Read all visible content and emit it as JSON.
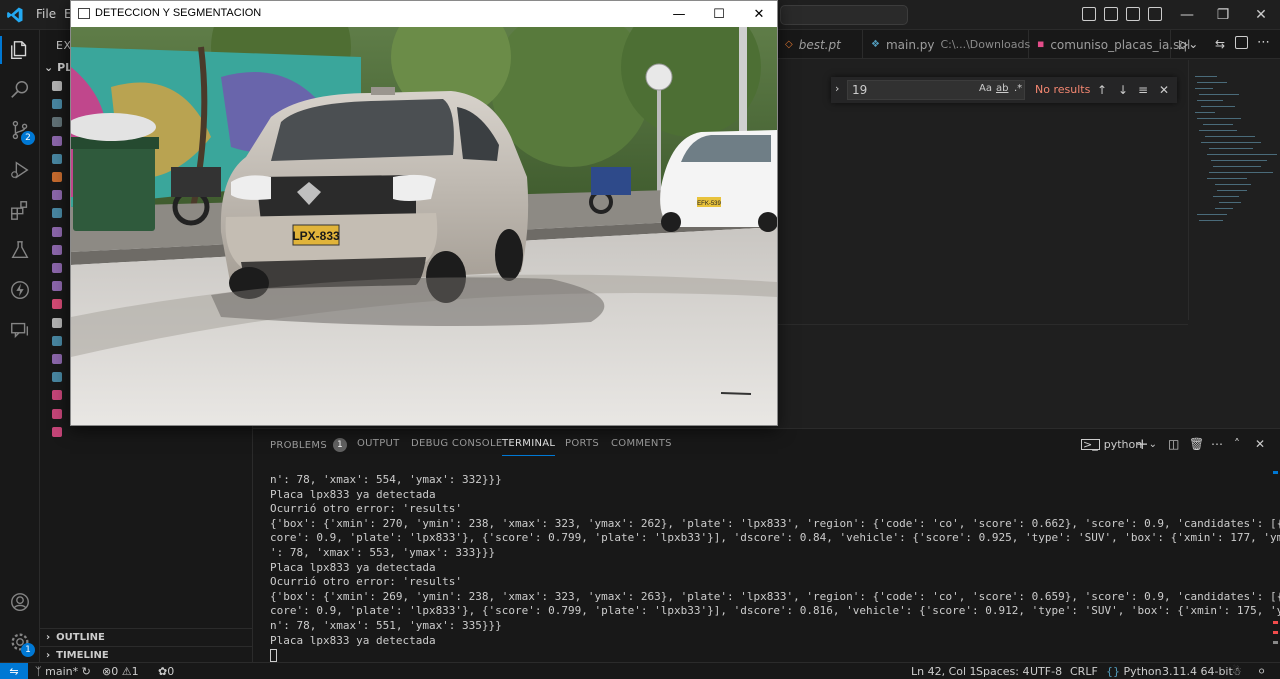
{
  "titlebar": {
    "menu": [
      "File",
      "E"
    ],
    "window_controls": [
      "minimize-icon",
      "restore-icon",
      "close-icon"
    ]
  },
  "activitybar": {
    "items": [
      "explorer-icon",
      "search-icon",
      "source-control-icon",
      "run-debug-icon",
      "extensions-icon",
      "testing-icon",
      "lightning-icon",
      "comments-icon"
    ],
    "source_control_badge": "2",
    "accounts_icon": "account-icon",
    "manage_badge": "1"
  },
  "sidebar": {
    "title": "EXP",
    "folder": "PLA",
    "outline": "OUTLINE",
    "timeline": "TIMELINE",
    "file_colors": [
      "#cccccc",
      "#519aba",
      "#6d8086",
      "#a074c4",
      "#519aba",
      "#e37933",
      "#a074c4",
      "#519aba",
      "#a074c4",
      "#a074c4",
      "#a074c4",
      "#a074c4",
      "#f55385",
      "#cccccc",
      "#519aba",
      "#a074c4",
      "#519aba",
      "#e44d8a",
      "#e44d8a",
      "#e44d8a"
    ]
  },
  "tabs": [
    {
      "label": "best.pt",
      "sub": ""
    },
    {
      "label": "main.py",
      "sub": "C:\\...\\Downloads"
    },
    {
      "label": "comuniso_placas_ia.sql",
      "sub": ""
    }
  ],
  "find": {
    "value": "19",
    "opt_case": "Aa",
    "opt_word": "ab",
    "opt_regex": ".*",
    "result": "No results"
  },
  "panel": {
    "tabs": [
      "PROBLEMS",
      "OUTPUT",
      "DEBUG CONSOLE",
      "TERMINAL",
      "PORTS",
      "COMMENTS"
    ],
    "problems_count": "1",
    "active_tab": "TERMINAL",
    "terminal_name": "python",
    "terminal_lines": [
      "n': 78, 'xmax': 554, 'ymax': 332}}}",
      "Placa lpx833 ya detectada",
      "Ocurrió otro error: 'results'",
      "{'box': {'xmin': 270, 'ymin': 238, 'xmax': 323, 'ymax': 262}, 'plate': 'lpx833', 'region': {'code': 'co', 'score': 0.662}, 'score': 0.9, 'candidates': [{'s",
      "core': 0.9, 'plate': 'lpx833'}, {'score': 0.799, 'plate': 'lpxb33'}], 'dscore': 0.84, 'vehicle': {'score': 0.925, 'type': 'SUV', 'box': {'xmin': 177, 'ymin",
      "': 78, 'xmax': 553, 'ymax': 333}}}",
      "Placa lpx833 ya detectada",
      "Ocurrió otro error: 'results'",
      "{'box': {'xmin': 269, 'ymin': 238, 'xmax': 323, 'ymax': 263}, 'plate': 'lpx833', 'region': {'code': 'co', 'score': 0.659}, 'score': 0.9, 'candidates': [{'s",
      "core': 0.9, 'plate': 'lpx833'}, {'score': 0.799, 'plate': 'lpxb33'}], 'dscore': 0.816, 'vehicle': {'score': 0.912, 'type': 'SUV', 'box': {'xmin': 175, 'ymi",
      "n': 78, 'xmax': 551, 'ymax': 335}}}",
      "Placa lpx833 ya detectada"
    ]
  },
  "statusbar": {
    "branch": "main*",
    "errors": "0",
    "warnings": "1",
    "ports": "0",
    "position": "Ln 42, Col 1",
    "spaces": "Spaces: 4",
    "encoding": "UTF-8",
    "eol": "CRLF",
    "language": "Python",
    "interpreter": "3.11.4 64-bit"
  },
  "cv_window": {
    "title": "DETECCION Y SEGMENTACION",
    "plate_text": "LPX-833",
    "plate_text_2": "EFK-539",
    "controls": [
      "minimize-icon",
      "maximize-icon",
      "close-icon"
    ]
  },
  "colors": {
    "accent": "#0078d4",
    "error_text": "#f48771"
  }
}
